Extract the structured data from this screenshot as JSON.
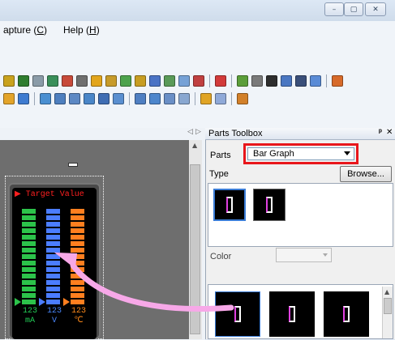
{
  "window": {
    "buttons": [
      {
        "name": "minimize",
        "glyph": "–"
      },
      {
        "name": "maximize",
        "glyph": "▢"
      },
      {
        "name": "close",
        "glyph": "✕"
      }
    ]
  },
  "menu": {
    "capture": {
      "label": "apture (",
      "key": "C",
      "end": ")"
    },
    "help": {
      "label": "Help (",
      "key": "H",
      "end": ")"
    }
  },
  "doc": {
    "tab_nav_left": "◁",
    "tab_nav_right": "▷",
    "device": {
      "target_label": "▶ Target Value",
      "readouts": [
        {
          "value": "123",
          "unit": "mA",
          "color": "#22cc55"
        },
        {
          "value": "123",
          "unit": "V",
          "color": "#4a88ff"
        },
        {
          "value": "123",
          "unit": "℃",
          "color": "#ff8a1a"
        }
      ]
    }
  },
  "panel": {
    "title": "Parts Toolbox",
    "pin": "ᵖ",
    "close": "✕",
    "parts_label": "Parts",
    "parts_value": "Bar Graph",
    "type_label": "Type",
    "browse_label": "Browse...",
    "color_label": "Color"
  },
  "colors": {
    "highlight": "#e8161b",
    "green": "#2cc34a",
    "blue": "#4b7dff",
    "orange": "#ff7f1f"
  }
}
